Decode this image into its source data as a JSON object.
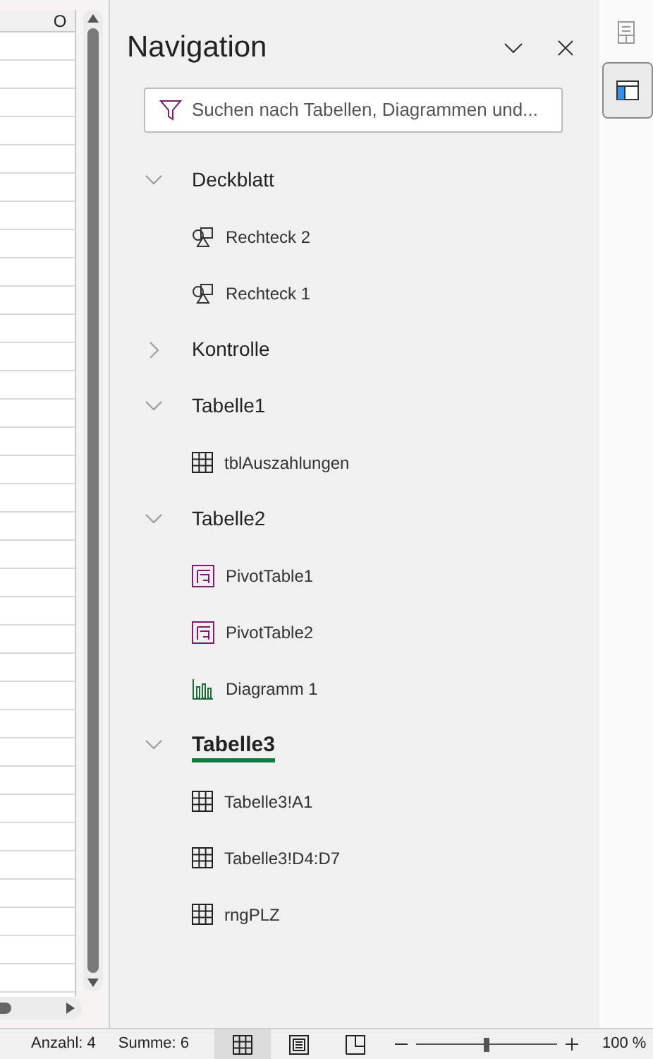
{
  "sheet": {
    "column_header": "O"
  },
  "panel": {
    "title": "Navigation",
    "search": {
      "placeholder": "Suchen nach Tabellen, Diagrammen und..."
    },
    "tree": [
      {
        "label": "Deckblatt",
        "expanded": true,
        "selected": false,
        "children": [
          {
            "label": "Rechteck 2",
            "kind": "shape"
          },
          {
            "label": "Rechteck 1",
            "kind": "shape"
          }
        ]
      },
      {
        "label": "Kontrolle",
        "expanded": false,
        "selected": false
      },
      {
        "label": "Tabelle1",
        "expanded": true,
        "selected": false,
        "children": [
          {
            "label": "tblAuszahlungen",
            "kind": "table"
          }
        ]
      },
      {
        "label": "Tabelle2",
        "expanded": true,
        "selected": false,
        "children": [
          {
            "label": "PivotTable1",
            "kind": "pivot"
          },
          {
            "label": "PivotTable2",
            "kind": "pivot"
          },
          {
            "label": "Diagramm 1",
            "kind": "chart"
          }
        ]
      },
      {
        "label": "Tabelle3",
        "expanded": true,
        "selected": true,
        "children": [
          {
            "label": "Tabelle3!A1",
            "kind": "range"
          },
          {
            "label": "Tabelle3!D4:D7",
            "kind": "range"
          },
          {
            "label": "rngPLZ",
            "kind": "range"
          }
        ]
      }
    ]
  },
  "rail": [
    {
      "kind": "sheet",
      "selected": false
    },
    {
      "kind": "layout",
      "selected": true
    }
  ],
  "status_bar": {
    "items": [
      "Anzahl: 4",
      "Summe: 6"
    ],
    "views": [
      {
        "kind": "normal",
        "selected": true
      },
      {
        "kind": "page",
        "selected": false
      },
      {
        "kind": "break",
        "selected": false
      }
    ],
    "zoom": {
      "level": 0.5,
      "reading": "100 %"
    }
  }
}
